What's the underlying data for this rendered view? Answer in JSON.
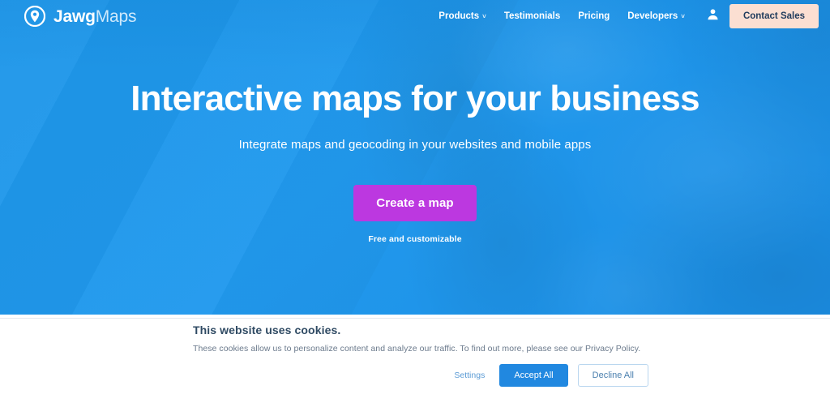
{
  "colors": {
    "hero_blue": "#2196ec",
    "cta_purple": "#bc38e0",
    "contact_peach": "#fbdfd2",
    "contact_text": "#1f3b5c",
    "accept_blue": "#2188e0",
    "decline_border": "#b9d6ef",
    "cookie_title": "#2f4a63",
    "cookie_text": "#6b7a8c",
    "settings_link": "#5b9bd5"
  },
  "nav": {
    "brand": {
      "icon": "jawgmaps-pin-logo-icon",
      "name_bold": "Jawg",
      "name_light": "Maps"
    },
    "links": [
      {
        "label": "Products",
        "caret": "˅",
        "has_dropdown": true
      },
      {
        "label": "Testimonials",
        "caret": "",
        "has_dropdown": false
      },
      {
        "label": "Pricing",
        "caret": "",
        "has_dropdown": false
      },
      {
        "label": "Developers",
        "caret": "˅",
        "has_dropdown": true
      }
    ],
    "account_icon": "user-account-icon",
    "contact_label": "Contact Sales"
  },
  "hero": {
    "headline": "Interactive maps for your business",
    "subheadline": "Integrate maps and geocoding in your websites and mobile apps",
    "cta_label": "Create a map",
    "cta_note": "Free and customizable"
  },
  "cookie_banner": {
    "title": "This website uses cookies.",
    "description": "These cookies allow us to personalize content and analyze our traffic. To find out more, please see our Privacy Policy.",
    "settings_label": "Settings",
    "accept_label": "Accept All",
    "decline_label": "Decline All"
  }
}
